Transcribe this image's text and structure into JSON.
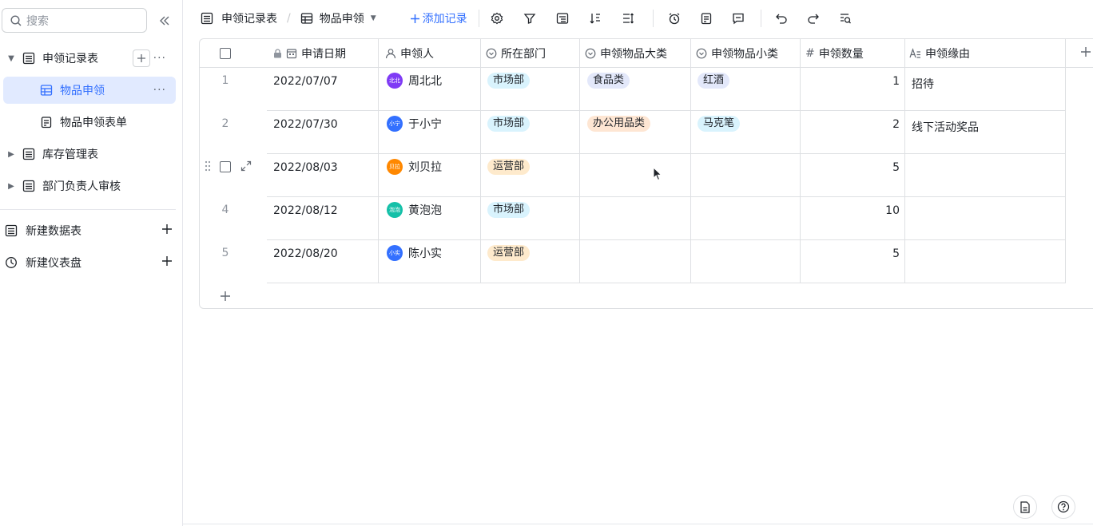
{
  "sidebar": {
    "search_placeholder": "搜索",
    "tree": [
      {
        "label": "申领记录表"
      },
      {
        "label": "物品申领"
      },
      {
        "label": "物品申领表单"
      },
      {
        "label": "库存管理表"
      },
      {
        "label": "部门负责人审核"
      }
    ],
    "new_table": "新建数据表",
    "new_dashboard": "新建仪表盘"
  },
  "toolbar": {
    "table_name": "申领记录表",
    "view_name": "物品申领",
    "add_record": "添加记录"
  },
  "grid": {
    "columns": [
      "申请日期",
      "申领人",
      "所在部门",
      "申领物品大类",
      "申领物品小类",
      "申领数量",
      "申领缘由"
    ],
    "rows": [
      {
        "num": "1",
        "date": "2022/07/07",
        "avatar": "北北",
        "avatar_color": "#7f3bf5",
        "person": "周北北",
        "dept": "市场部",
        "cat": "食品类",
        "sub": "红酒",
        "qty": "1",
        "reason": "招待"
      },
      {
        "num": "2",
        "date": "2022/07/30",
        "avatar": "小宁",
        "avatar_color": "#3370ff",
        "person": "于小宁",
        "dept": "市场部",
        "cat": "办公用品类",
        "sub": "马克笔",
        "qty": "2",
        "reason": "线下活动奖品"
      },
      {
        "num": "3",
        "date": "2022/08/03",
        "avatar": "贝拉",
        "avatar_color": "#ff8800",
        "person": "刘贝拉",
        "dept": "运营部",
        "cat": "",
        "sub": "",
        "qty": "5",
        "reason": ""
      },
      {
        "num": "4",
        "date": "2022/08/12",
        "avatar": "泡泡",
        "avatar_color": "#14c0a8",
        "person": "黄泡泡",
        "dept": "市场部",
        "cat": "",
        "sub": "",
        "qty": "10",
        "reason": ""
      },
      {
        "num": "5",
        "date": "2022/08/20",
        "avatar": "小实",
        "avatar_color": "#3370ff",
        "person": "陈小实",
        "dept": "运营部",
        "cat": "",
        "sub": "",
        "qty": "5",
        "reason": ""
      }
    ]
  },
  "colors": {
    "accent": "#3370ff",
    "border": "#dee0e3",
    "selected_bg": "#e1eaff"
  }
}
